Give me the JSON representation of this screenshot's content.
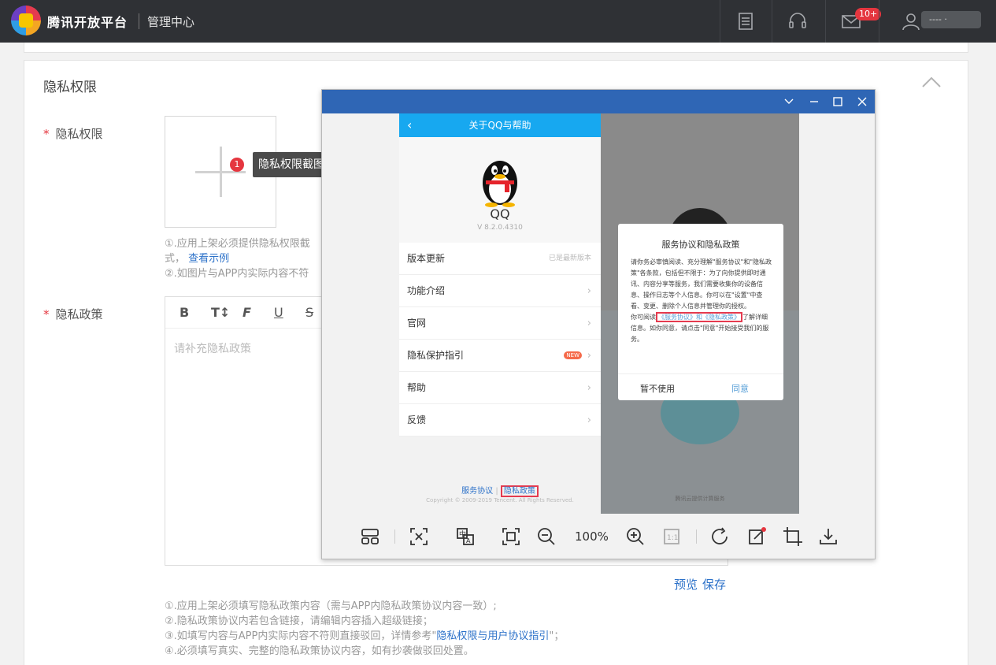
{
  "header": {
    "brand": "腾讯开放平台",
    "subtitle": "管理中心",
    "mail_badge": "10+",
    "username": "---- ·"
  },
  "section": {
    "title": "隐私权限"
  },
  "privacy_screenshot": {
    "label": "隐私权限",
    "tip_number": "1",
    "tooltip": "隐私权限截图。例如：",
    "hint1": "①.应用上架必须提供隐私权限截",
    "hint1b": "式，",
    "hint_link": "查看示例",
    "hint2": "②.如图片与APP内实际内容不符"
  },
  "privacy_policy": {
    "label": "隐私政策",
    "toolbar": [
      "B",
      "T↕",
      "F",
      "U",
      "S"
    ],
    "placeholder": "请补充隐私政策",
    "preview": "预览",
    "save": "保存",
    "hints": [
      "①.应用上架必须填写隐私政策内容（需与APP内隐私政策协议内容一致）;",
      "②.隐私政策协议内若包含链接，请编辑内容插入超级链接；"
    ],
    "hint3_pre": "③.如填写内容与APP内实际内容不符则直接驳回，详情参考\"",
    "hint3_link": "隐私权限与用户协议指引",
    "hint3_post": "\"；",
    "hint4": "④.必须填写真实、完整的隐私政策协议内容，如有抄袭做驳回处置。"
  },
  "viewer": {
    "zoom": "100%",
    "left_screen": {
      "header": "关于QQ与帮助",
      "app_name": "QQ",
      "version": "V 8.2.0.4310",
      "rows": [
        {
          "label": "版本更新",
          "right": "已是最新版本"
        },
        {
          "label": "功能介绍",
          "right": "›"
        },
        {
          "label": "官网",
          "right": "›"
        },
        {
          "label": "隐私保护指引",
          "right": "›",
          "badge": "NEW"
        },
        {
          "label": "帮助",
          "right": "›"
        },
        {
          "label": "反馈",
          "right": "›"
        }
      ],
      "link1": "服务协议",
      "link_sep": "|",
      "link2": "隐私政策",
      "copyright": "Copyright © 2009-2019 Tencent. All Rights Reserved."
    },
    "right_screen": {
      "dialog_title": "服务协议和隐私政策",
      "body1": "请你务必审慎阅读、充分理解\"服务协议\"和\"隐私政策\"各条款，包括但不限于：为了向你提供即时通讯、内容分享等服务，我们需要收集你的设备信息、操作日志等个人信息。你可以在\"设置\"中查看、变更、删除个人信息并管理你的授权。",
      "body2_pre": "你可阅读",
      "body2_link": "《服务协议》和《隐私政策》",
      "body2_post": "了解详细信息。如你同意，请点击\"同意\"开始接受我们的服务。",
      "btn_decline": "暂不使用",
      "btn_agree": "同意",
      "footer": "腾讯云提供计算服务"
    }
  }
}
